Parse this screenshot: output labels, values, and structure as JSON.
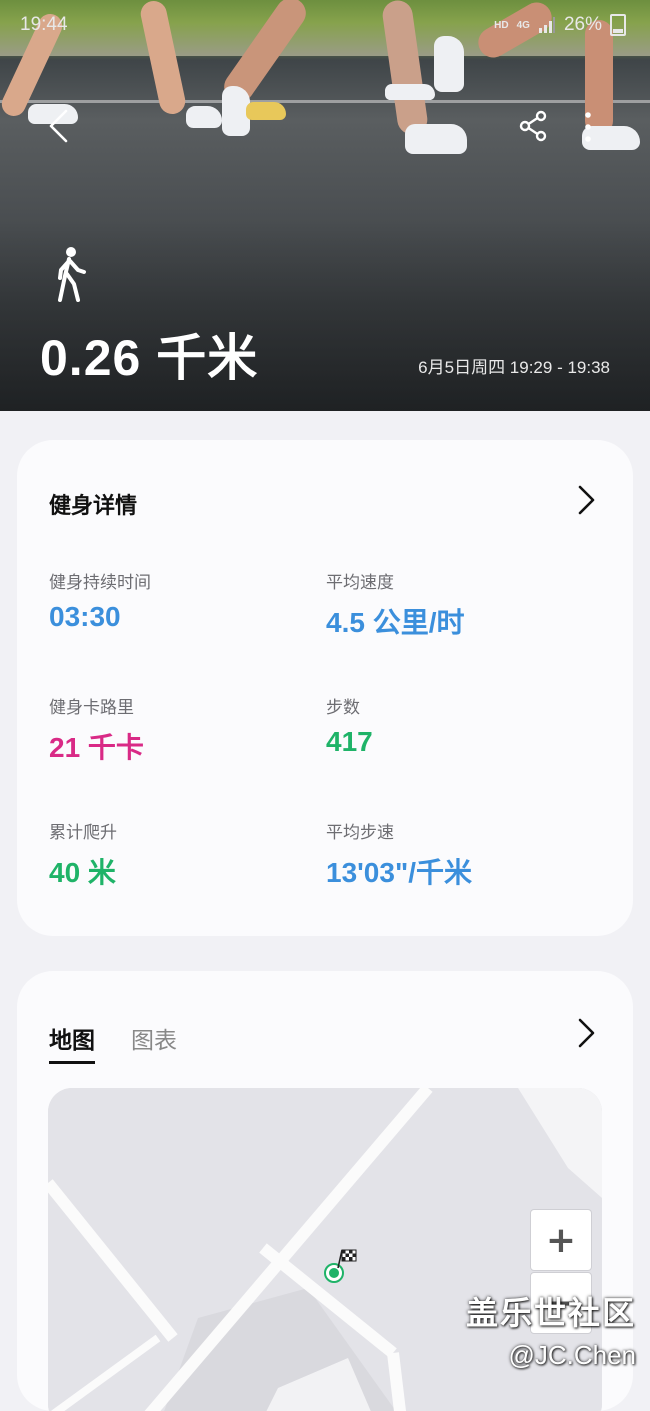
{
  "status_bar": {
    "time": "19:44",
    "hd": "HD",
    "network": "4G",
    "battery": "26%"
  },
  "hero": {
    "distance": "0.26 千米",
    "datetime": "6月5日周四 19:29 - 19:38",
    "activity_icon": "walk-icon"
  },
  "details": {
    "title": "健身详情",
    "metrics": [
      {
        "label": "健身持续时间",
        "value": "03:30",
        "color": "#3b8fdc"
      },
      {
        "label": "平均速度",
        "value": "4.5 公里/时",
        "color": "#3b8fdc"
      },
      {
        "label": "健身卡路里",
        "value": "21 千卡",
        "color": "#d92a86"
      },
      {
        "label": "步数",
        "value": "417",
        "color": "#1fb368"
      },
      {
        "label": "累计爬升",
        "value": "40 米",
        "color": "#1fb368"
      },
      {
        "label": "平均步速",
        "value": "13'03\"/千米",
        "color": "#3b8fdc"
      }
    ]
  },
  "map_card": {
    "tabs": [
      {
        "label": "地图",
        "active": true
      },
      {
        "label": "图表",
        "active": false
      }
    ],
    "zoom_in": "+",
    "zoom_out": "−"
  },
  "watermark": {
    "line1": "盖乐世社区",
    "line2": "@JC.Chen"
  }
}
